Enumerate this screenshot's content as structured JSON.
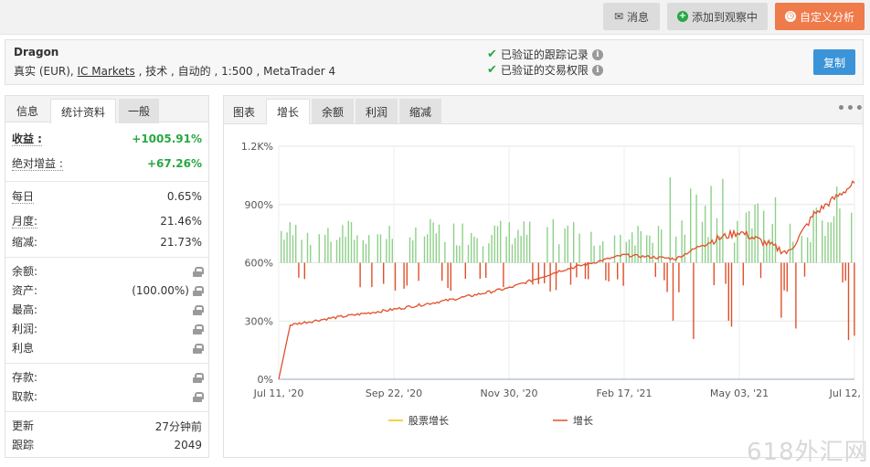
{
  "toolbar": {
    "messages_label": "消息",
    "watch_label": "添加到观察中",
    "analysis_label": "自定义分析"
  },
  "account": {
    "name": "Dragon",
    "details_prefix": "真实 (EUR), ",
    "broker": "IC Markets",
    "details_suffix": " , 技术 , 自动的 , 1:500 , MetaTrader 4",
    "verified_track": "已验证的跟踪记录",
    "verified_access": "已验证的交易权限",
    "copy_label": "复制"
  },
  "left_tabs": [
    "信息",
    "统计资料",
    "一般"
  ],
  "stats": {
    "gain_label": "收益 :",
    "gain_value": "+1005.91%",
    "abs_gain_label": "绝对增益 :",
    "abs_gain_value": "+67.26%",
    "daily_label": "每日",
    "daily_value": "0.65%",
    "monthly_label": "月度:",
    "monthly_value": "21.46%",
    "drawdown_label": "缩减:",
    "drawdown_value": "21.73%",
    "balance_label": "余额:",
    "equity_label": "资产:",
    "equity_value": "(100.00%)",
    "highest_label": "最高:",
    "profit_label": "利润:",
    "interest_label": "利息",
    "deposits_label": "存款:",
    "withdrawals_label": "取款:",
    "updated_label": "更新",
    "updated_value": "27分钟前",
    "tracking_label": "跟踪",
    "tracking_value": "2049"
  },
  "chart_tabs": [
    "图表",
    "增长",
    "余额",
    "利润",
    "缩减"
  ],
  "chart_data": {
    "type": "line",
    "ylabel": "",
    "y_ticks": [
      "0%",
      "300%",
      "600%",
      "900%",
      "1.2K%"
    ],
    "ylim": [
      0,
      1200
    ],
    "x_ticks": [
      "Jul 11, '20",
      "Sep 22, '20",
      "Nov 30, '20",
      "Feb 17, '21",
      "May 03, '21",
      "Jul 12, '21"
    ],
    "legend": [
      "股票增长",
      "增长"
    ],
    "series": [
      {
        "name": "增长",
        "color": "#e0502a",
        "x": [
          "Jul 11, '20",
          "Jul 20, '20",
          "Aug 10, '20",
          "Sep 22, '20",
          "Oct 20, '20",
          "Nov 30, '20",
          "Dec 30, '20",
          "Feb 17, '21",
          "Mar 20, '21",
          "Apr 15, '21",
          "May 03, '21",
          "Jun 01, '21",
          "Jun 20, '21",
          "Jul 12, '21"
        ],
        "values": [
          0,
          280,
          310,
          360,
          410,
          470,
          560,
          640,
          620,
          700,
          760,
          650,
          850,
          1010
        ]
      }
    ],
    "bars_note": "daily gain (green) / loss (red) bars around 600% baseline"
  },
  "watermark": "618外汇网",
  "colors": {
    "accent_orange": "#ef7a4a",
    "copy_blue": "#3b93d8",
    "gain_green": "#27a843",
    "loss_red": "#e0502a"
  }
}
